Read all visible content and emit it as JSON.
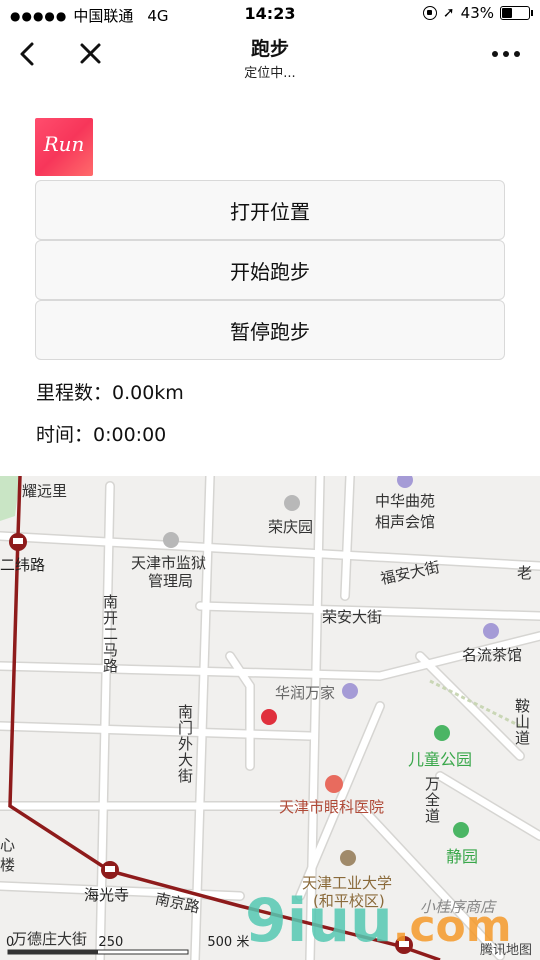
{
  "status_bar": {
    "signal": "●●●●●",
    "carrier": "中国联通",
    "network": "4G",
    "time": "14:23",
    "battery_percent": "43%",
    "battery_level": 0.43
  },
  "nav": {
    "title": "跑步",
    "subtitle": "定位中..."
  },
  "app_logo_text": "Run",
  "buttons": {
    "open_location": "打开位置",
    "start_run": "开始跑步",
    "pause_run": "暂停跑步"
  },
  "stats": {
    "distance": "里程数：0.00km",
    "time": "时间：0:00:00"
  },
  "map": {
    "labels": {
      "yaoyuanli": "耀远里",
      "zhonghua": "中华曲苑",
      "xiangsheng": "相声会馆",
      "rongqing": "荣庆园",
      "jianyu": "天津市监狱",
      "guanliju": "管理局",
      "erweilu": "二纬路",
      "fuan": "福安大街",
      "lao": "老",
      "nankai": "南开二马路",
      "rongan": "荣安大街",
      "mingliu": "名流茶馆",
      "huarun": "华润万家",
      "nanmen": "南门外大街",
      "ertong": "儿童公园",
      "anshan": "鞍山道",
      "wanquan": "万全道",
      "yanke": "天津市眼科医院",
      "jingyuan": "静园",
      "xin": "心",
      "lou": "楼",
      "haiguangsi": "海光寺",
      "nanjing": "南京路",
      "gongye": "天津工业大学",
      "heping": "(和平校区)",
      "wandezhuang": "万德庄大街",
      "sign": "小桂序商店",
      "wat": "瞎"
    },
    "scale": {
      "s0": "0",
      "s250": "250",
      "s500": "500 米"
    },
    "watermark": {
      "main": "9iuu",
      "com": ".com"
    },
    "provider": "腾讯地图"
  },
  "colors": {
    "metro_line": "#8e1b1b",
    "marker": "#e0303d",
    "logo_gradient": "#f7365a",
    "button_bg": "#f8f8f8"
  }
}
